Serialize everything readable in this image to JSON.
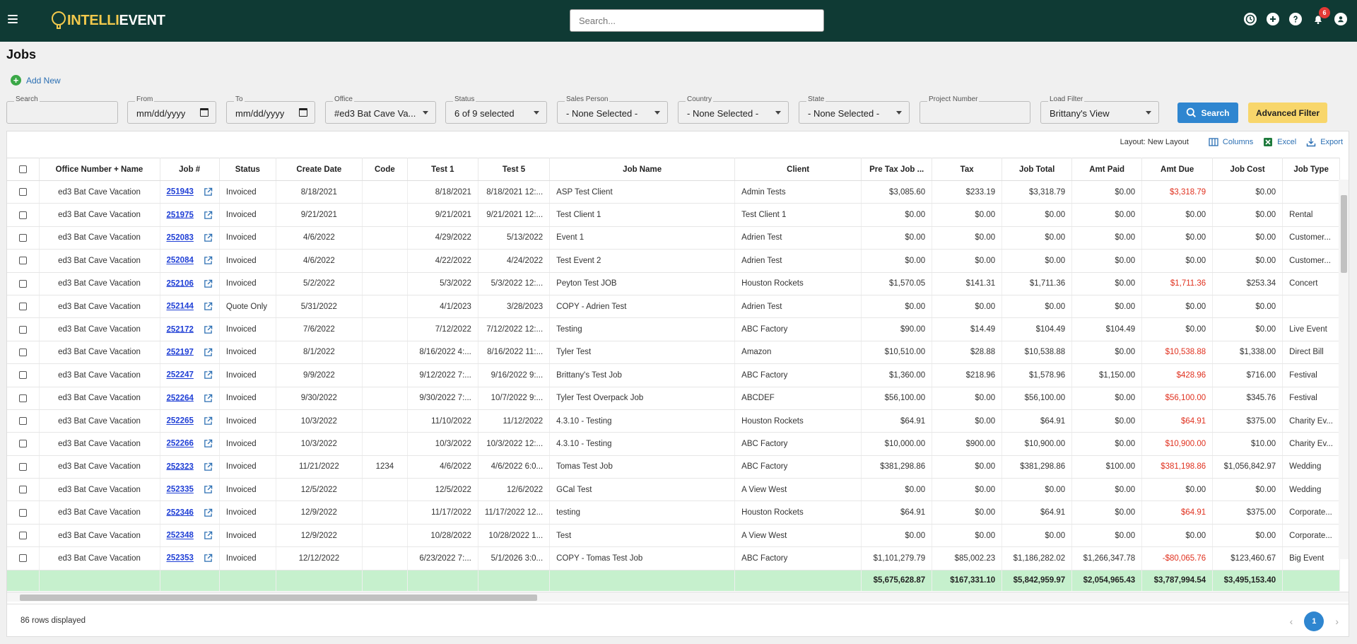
{
  "header": {
    "logo_part1": "INTELLI",
    "logo_part2": "EVENT",
    "search_placeholder": "Search...",
    "notification_count": "6",
    "icons": [
      "history-icon",
      "add-icon",
      "help-icon",
      "bell-icon",
      "user-icon"
    ]
  },
  "page": {
    "title": "Jobs",
    "add_new_label": "Add New"
  },
  "filters": {
    "search": {
      "label": "Search",
      "value": ""
    },
    "from": {
      "label": "From",
      "value": "mm/dd/yyyy"
    },
    "to": {
      "label": "To",
      "value": "mm/dd/yyyy"
    },
    "office": {
      "label": "Office",
      "value": "#ed3 Bat Cave Va..."
    },
    "status": {
      "label": "Status",
      "value": "6 of 9 selected"
    },
    "sales_person": {
      "label": "Sales Person",
      "value": "- None Selected -"
    },
    "country": {
      "label": "Country",
      "value": "- None Selected -"
    },
    "state": {
      "label": "State",
      "value": "- None Selected -"
    },
    "project_number": {
      "label": "Project Number",
      "value": ""
    },
    "load_filter": {
      "label": "Load Filter",
      "value": "Brittany's View"
    },
    "search_button": "Search",
    "advanced_filter_button": "Advanced Filter"
  },
  "toolbar": {
    "layout": "Layout: New Layout",
    "columns": "Columns",
    "excel": "Excel",
    "export": "Export"
  },
  "columns": [
    "Office Number + Name",
    "Job #",
    "Status",
    "Create Date",
    "Code",
    "Test 1",
    "Test 5",
    "Job Name",
    "Client",
    "Pre Tax Job ...",
    "Tax",
    "Job Total",
    "Amt Paid",
    "Amt Due",
    "Job Cost",
    "Job Type"
  ],
  "rows": [
    {
      "office": "ed3 Bat Cave Vacation",
      "job": "251943",
      "status": "Invoiced",
      "create": "8/18/2021",
      "code": "",
      "test1": "8/18/2021",
      "test5": "8/18/2021 12:...",
      "name": "ASP Test Client",
      "client": "Admin Tests",
      "pretax": "$3,085.60",
      "tax": "$233.19",
      "total": "$3,318.79",
      "paid": "$0.00",
      "due": "$3,318.79",
      "due_neg": true,
      "cost": "$0.00",
      "type": ""
    },
    {
      "office": "ed3 Bat Cave Vacation",
      "job": "251975",
      "status": "Invoiced",
      "create": "9/21/2021",
      "code": "",
      "test1": "9/21/2021",
      "test5": "9/21/2021 12:...",
      "name": "Test Client 1",
      "client": "Test Client 1",
      "pretax": "$0.00",
      "tax": "$0.00",
      "total": "$0.00",
      "paid": "$0.00",
      "due": "$0.00",
      "due_neg": false,
      "cost": "$0.00",
      "type": "Rental"
    },
    {
      "office": "ed3 Bat Cave Vacation",
      "job": "252083",
      "status": "Invoiced",
      "create": "4/6/2022",
      "code": "",
      "test1": "4/29/2022",
      "test5": "5/13/2022",
      "name": "Event 1",
      "client": "Adrien Test",
      "pretax": "$0.00",
      "tax": "$0.00",
      "total": "$0.00",
      "paid": "$0.00",
      "due": "$0.00",
      "due_neg": false,
      "cost": "$0.00",
      "type": "Customer..."
    },
    {
      "office": "ed3 Bat Cave Vacation",
      "job": "252084",
      "status": "Invoiced",
      "create": "4/6/2022",
      "code": "",
      "test1": "4/22/2022",
      "test5": "4/24/2022",
      "name": "Test Event 2",
      "client": "Adrien Test",
      "pretax": "$0.00",
      "tax": "$0.00",
      "total": "$0.00",
      "paid": "$0.00",
      "due": "$0.00",
      "due_neg": false,
      "cost": "$0.00",
      "type": "Customer..."
    },
    {
      "office": "ed3 Bat Cave Vacation",
      "job": "252106",
      "status": "Invoiced",
      "create": "5/2/2022",
      "code": "",
      "test1": "5/3/2022",
      "test5": "5/3/2022 12:...",
      "name": "Peyton Test JOB",
      "client": "Houston Rockets",
      "pretax": "$1,570.05",
      "tax": "$141.31",
      "total": "$1,711.36",
      "paid": "$0.00",
      "due": "$1,711.36",
      "due_neg": true,
      "cost": "$253.34",
      "type": "Concert"
    },
    {
      "office": "ed3 Bat Cave Vacation",
      "job": "252144",
      "status": "Quote Only",
      "create": "5/31/2022",
      "code": "",
      "test1": "4/1/2023",
      "test5": "3/28/2023",
      "name": "COPY - Adrien Test",
      "client": "Adrien Test",
      "pretax": "$0.00",
      "tax": "$0.00",
      "total": "$0.00",
      "paid": "$0.00",
      "due": "$0.00",
      "due_neg": false,
      "cost": "$0.00",
      "type": ""
    },
    {
      "office": "ed3 Bat Cave Vacation",
      "job": "252172",
      "status": "Invoiced",
      "create": "7/6/2022",
      "code": "",
      "test1": "7/12/2022",
      "test5": "7/12/2022 12:...",
      "name": "Testing",
      "client": "ABC Factory",
      "pretax": "$90.00",
      "tax": "$14.49",
      "total": "$104.49",
      "paid": "$104.49",
      "due": "$0.00",
      "due_neg": false,
      "cost": "$0.00",
      "type": "Live Event"
    },
    {
      "office": "ed3 Bat Cave Vacation",
      "job": "252197",
      "status": "Invoiced",
      "create": "8/1/2022",
      "code": "",
      "test1": "8/16/2022 4:...",
      "test5": "8/16/2022 11:...",
      "name": "Tyler Test",
      "client": "Amazon",
      "pretax": "$10,510.00",
      "tax": "$28.88",
      "total": "$10,538.88",
      "paid": "$0.00",
      "due": "$10,538.88",
      "due_neg": true,
      "cost": "$1,338.00",
      "type": "Direct Bill"
    },
    {
      "office": "ed3 Bat Cave Vacation",
      "job": "252247",
      "status": "Invoiced",
      "create": "9/9/2022",
      "code": "",
      "test1": "9/12/2022 7:...",
      "test5": "9/16/2022 9:...",
      "name": "Brittany's Test Job",
      "client": "ABC Factory",
      "pretax": "$1,360.00",
      "tax": "$218.96",
      "total": "$1,578.96",
      "paid": "$1,150.00",
      "due": "$428.96",
      "due_neg": true,
      "cost": "$716.00",
      "type": "Festival"
    },
    {
      "office": "ed3 Bat Cave Vacation",
      "job": "252264",
      "status": "Invoiced",
      "create": "9/30/2022",
      "code": "",
      "test1": "9/30/2022 7:...",
      "test5": "10/7/2022 9:...",
      "name": "Tyler Test Overpack Job",
      "client": "ABCDEF",
      "pretax": "$56,100.00",
      "tax": "$0.00",
      "total": "$56,100.00",
      "paid": "$0.00",
      "due": "$56,100.00",
      "due_neg": true,
      "cost": "$345.76",
      "type": "Festival"
    },
    {
      "office": "ed3 Bat Cave Vacation",
      "job": "252265",
      "status": "Invoiced",
      "create": "10/3/2022",
      "code": "",
      "test1": "11/10/2022",
      "test5": "11/12/2022",
      "name": "4.3.10 - Testing",
      "client": "Houston Rockets",
      "pretax": "$64.91",
      "tax": "$0.00",
      "total": "$64.91",
      "paid": "$0.00",
      "due": "$64.91",
      "due_neg": true,
      "cost": "$375.00",
      "type": "Charity Ev..."
    },
    {
      "office": "ed3 Bat Cave Vacation",
      "job": "252266",
      "status": "Invoiced",
      "create": "10/3/2022",
      "code": "",
      "test1": "10/3/2022",
      "test5": "10/3/2022 12:...",
      "name": "4.3.10 - Testing",
      "client": "ABC Factory",
      "pretax": "$10,000.00",
      "tax": "$900.00",
      "total": "$10,900.00",
      "paid": "$0.00",
      "due": "$10,900.00",
      "due_neg": true,
      "cost": "$10.00",
      "type": "Charity Ev..."
    },
    {
      "office": "ed3 Bat Cave Vacation",
      "job": "252323",
      "status": "Invoiced",
      "create": "11/21/2022",
      "code": "1234",
      "test1": "4/6/2022",
      "test5": "4/6/2022 6:0...",
      "name": "Tomas Test Job",
      "client": "ABC Factory",
      "pretax": "$381,298.86",
      "tax": "$0.00",
      "total": "$381,298.86",
      "paid": "$100.00",
      "due": "$381,198.86",
      "due_neg": true,
      "cost": "$1,056,842.97",
      "type": "Wedding"
    },
    {
      "office": "ed3 Bat Cave Vacation",
      "job": "252335",
      "status": "Invoiced",
      "create": "12/5/2022",
      "code": "",
      "test1": "12/5/2022",
      "test5": "12/6/2022",
      "name": "GCal Test",
      "client": "A View West",
      "pretax": "$0.00",
      "tax": "$0.00",
      "total": "$0.00",
      "paid": "$0.00",
      "due": "$0.00",
      "due_neg": false,
      "cost": "$0.00",
      "type": "Wedding"
    },
    {
      "office": "ed3 Bat Cave Vacation",
      "job": "252346",
      "status": "Invoiced",
      "create": "12/9/2022",
      "code": "",
      "test1": "11/17/2022",
      "test5": "11/17/2022 12...",
      "name": "testing",
      "client": "Houston Rockets",
      "pretax": "$64.91",
      "tax": "$0.00",
      "total": "$64.91",
      "paid": "$0.00",
      "due": "$64.91",
      "due_neg": true,
      "cost": "$375.00",
      "type": "Corporate..."
    },
    {
      "office": "ed3 Bat Cave Vacation",
      "job": "252348",
      "status": "Invoiced",
      "create": "12/9/2022",
      "code": "",
      "test1": "10/28/2022",
      "test5": "10/28/2022 1...",
      "name": "Test",
      "client": "A View West",
      "pretax": "$0.00",
      "tax": "$0.00",
      "total": "$0.00",
      "paid": "$0.00",
      "due": "$0.00",
      "due_neg": false,
      "cost": "$0.00",
      "type": "Corporate..."
    },
    {
      "office": "ed3 Bat Cave Vacation",
      "job": "252353",
      "status": "Invoiced",
      "create": "12/12/2022",
      "code": "",
      "test1": "6/23/2022 7:...",
      "test5": "5/1/2026 3:0...",
      "name": "COPY - Tomas Test Job",
      "client": "ABC Factory",
      "pretax": "$1,101,279.79",
      "tax": "$85,002.23",
      "total": "$1,186,282.02",
      "paid": "$1,266,347.78",
      "due": "-$80,065.76",
      "due_neg": true,
      "cost": "$123,460.67",
      "type": "Big Event"
    }
  ],
  "totals": {
    "pretax": "$5,675,628.87",
    "tax": "$167,331.10",
    "total": "$5,842,959.97",
    "paid": "$2,054,965.43",
    "due": "$3,787,994.54",
    "cost": "$3,495,153.40"
  },
  "footer": {
    "rows_displayed": "86 rows displayed",
    "current_page": "1"
  },
  "colors": {
    "topbar": "#0f3a34",
    "accent": "#2f86d0",
    "negative": "#e0311f",
    "total_row": "#c6f0cd",
    "advanced_filter": "#f8d66b"
  }
}
